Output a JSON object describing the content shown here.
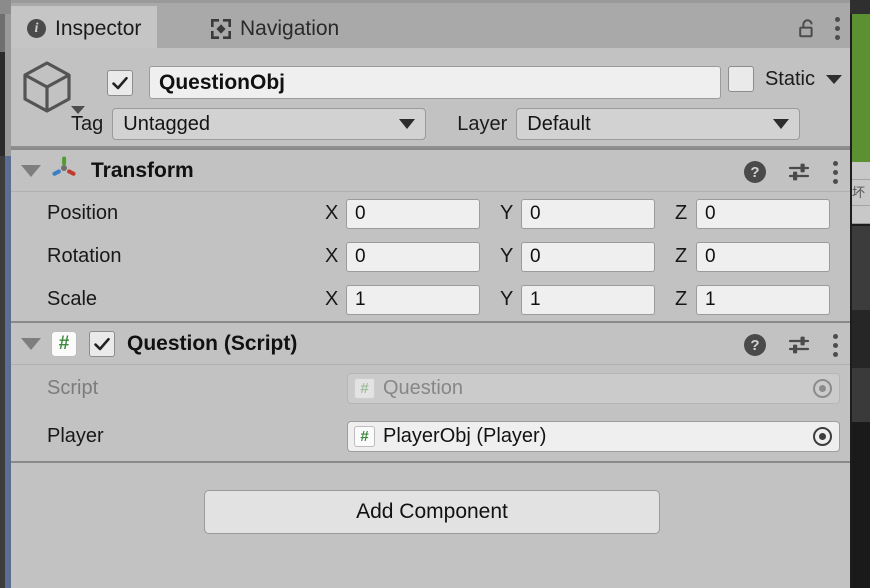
{
  "window": {
    "tabs": [
      {
        "id": "inspector",
        "label": "Inspector",
        "icon": "info-icon",
        "active": true
      },
      {
        "id": "navigation",
        "label": "Navigation",
        "icon": "navigation-icon",
        "active": false
      }
    ],
    "tools": [
      {
        "id": "lock",
        "icon": "lock-open-icon"
      },
      {
        "id": "menu",
        "icon": "kebab-menu-icon"
      }
    ]
  },
  "object_header": {
    "icon": "gameobject-cube-icon",
    "enabled_checkbox": true,
    "name": "QuestionObj",
    "static_label": "Static",
    "static_checkbox": false,
    "tag_label": "Tag",
    "tag_value": "Untagged",
    "layer_label": "Layer",
    "layer_value": "Default"
  },
  "components": [
    {
      "id": "transform",
      "title": "Transform",
      "icon": "transform-axis-icon",
      "expanded": true,
      "has_enable_checkbox": false,
      "tools": [
        "help-icon",
        "preset-icon",
        "kebab-menu-icon"
      ],
      "rows": [
        {
          "label": "Position",
          "axes": [
            {
              "letter": "X",
              "value": "0"
            },
            {
              "letter": "Y",
              "value": "0"
            },
            {
              "letter": "Z",
              "value": "0"
            }
          ]
        },
        {
          "label": "Rotation",
          "axes": [
            {
              "letter": "X",
              "value": "0"
            },
            {
              "letter": "Y",
              "value": "0"
            },
            {
              "letter": "Z",
              "value": "0"
            }
          ]
        },
        {
          "label": "Scale",
          "axes": [
            {
              "letter": "X",
              "value": "1"
            },
            {
              "letter": "Y",
              "value": "1"
            },
            {
              "letter": "Z",
              "value": "1"
            }
          ]
        }
      ]
    },
    {
      "id": "question-script",
      "title": "Question (Script)",
      "icon": "csharp-script-icon",
      "expanded": true,
      "has_enable_checkbox": true,
      "enabled": true,
      "tools": [
        "help-icon",
        "preset-icon",
        "kebab-menu-icon"
      ],
      "fields": [
        {
          "label": "Script",
          "value": "Question",
          "icon": "csharp-script-icon",
          "disabled": true,
          "picker": "object-picker-icon"
        },
        {
          "label": "Player",
          "value": "PlayerObj (Player)",
          "icon": "csharp-script-icon",
          "disabled": false,
          "picker": "object-picker-icon"
        }
      ]
    }
  ],
  "footer": {
    "add_component_label": "Add Component"
  },
  "colors": {
    "panel_bg": "#c2c2c2",
    "tabbar_bg": "#a9a9a9",
    "tab_active_bg": "#c5c5c5",
    "field_bg": "#efefef",
    "selection_accent": "#5b6e92",
    "script_green": "#3c8a3c",
    "axis_x_red": "#c0392b",
    "axis_y_green": "#4f9f2f",
    "axis_z_blue": "#3b7fc4",
    "scene_green": "#5b9130"
  },
  "side_panels": {
    "right_row_text": "坏和"
  }
}
